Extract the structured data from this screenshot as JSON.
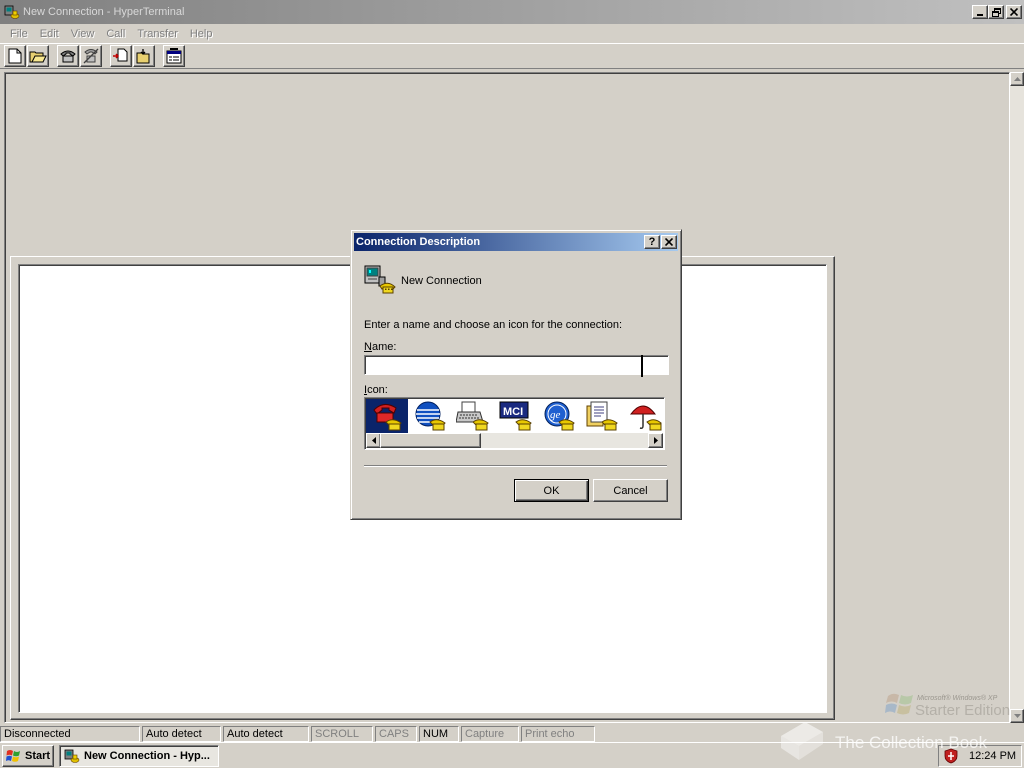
{
  "window": {
    "title": "New Connection - HyperTerminal",
    "controls": {
      "minimize": "_",
      "restore": "❐",
      "close": "✕"
    }
  },
  "menu": [
    "File",
    "Edit",
    "View",
    "Call",
    "Transfer",
    "Help"
  ],
  "toolbar": {
    "buttons": [
      "new-icon",
      "open-icon",
      "connect-icon",
      "disconnect-icon",
      "send-icon",
      "receive-icon",
      "properties-icon"
    ]
  },
  "statusbar": {
    "connection": "Disconnected",
    "detect1": "Auto detect",
    "detect2": "Auto detect",
    "scroll": "SCROLL",
    "caps": "CAPS",
    "num": "NUM",
    "capture": "Capture",
    "print_echo": "Print echo"
  },
  "dialog": {
    "title": "Connection Description",
    "help_btn": "?",
    "close_btn": "✕",
    "heading": "New Connection",
    "prompt": "Enter a name and choose an icon for the connection:",
    "name_label": "Name:",
    "name_value": "",
    "icon_label": "Icon:",
    "icons": [
      "phone-red-icon",
      "globe-icon",
      "typewriter-icon",
      "mci-icon",
      "ge-icon",
      "documents-icon",
      "umbrella-icon"
    ],
    "ok_label": "OK",
    "cancel_label": "Cancel"
  },
  "taskbar": {
    "start_label": "Start",
    "task_label": "New Connection - Hyp...",
    "clock": "12:24 PM"
  },
  "watermark": {
    "edition_small": "Microsoft® Windows® XP",
    "edition_big": "Starter Edition",
    "collection": "The Collection Book"
  },
  "colors": {
    "face": "#d4d0c8",
    "dialog_title_start": "#0a246a",
    "dialog_title_end": "#a6caf0",
    "inactive_title_start": "#808080"
  }
}
